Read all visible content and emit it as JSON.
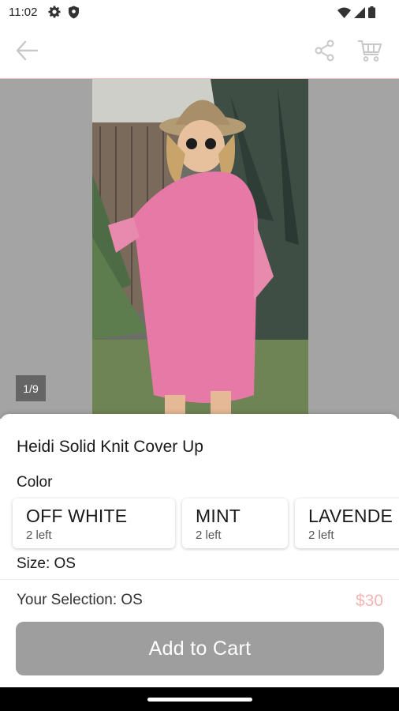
{
  "status_bar": {
    "time": "11:02",
    "left_icons": [
      "gear-icon",
      "shield-icon"
    ],
    "right_icons": [
      "wifi-icon",
      "signal-icon",
      "battery-icon"
    ]
  },
  "app_bar": {
    "back_icon": "arrow-left-icon",
    "share_icon": "share-icon",
    "cart_icon": "cart-icon"
  },
  "gallery": {
    "page_indicator": "1/9"
  },
  "product": {
    "title": "Heidi Solid Knit Cover Up",
    "color_label": "Color",
    "colors": [
      {
        "name": "OFF WHITE",
        "stock": "2 left"
      },
      {
        "name": "MINT",
        "stock": "2 left"
      },
      {
        "name": "LAVENDE",
        "stock": "2 left"
      }
    ],
    "size_label": "Size: OS",
    "selection_text": "Your Selection: OS",
    "price": "$30",
    "add_to_cart_label": "Add to Cart"
  },
  "colors": {
    "accent": "#f4b4b4",
    "button_disabled": "#9e9e9e",
    "divider": "#f3bcbc"
  }
}
